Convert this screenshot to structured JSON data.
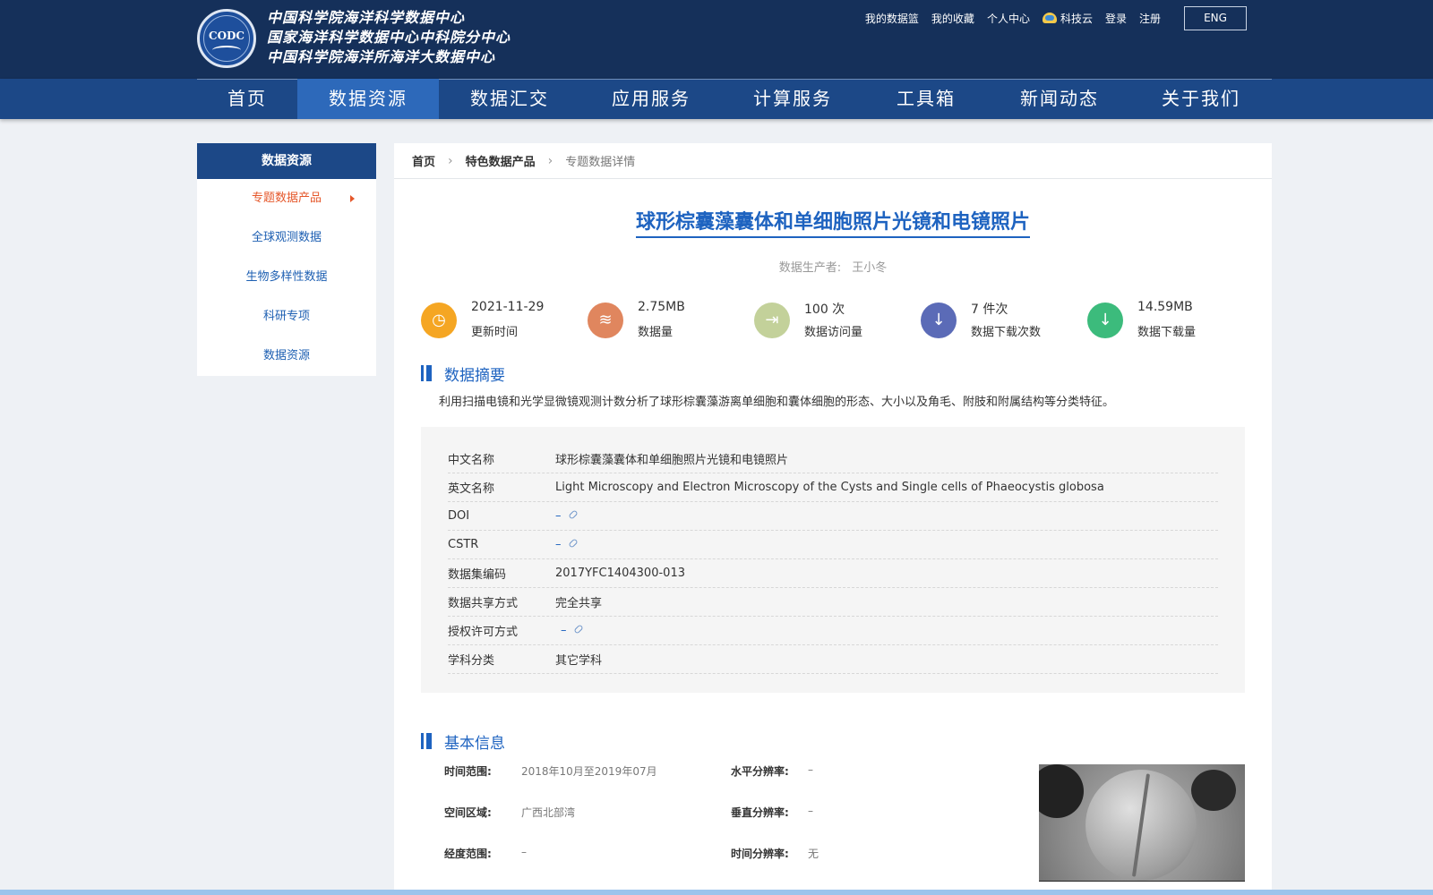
{
  "header": {
    "logo_text": "CODC",
    "org_names": [
      "中国科学院海洋科学数据中心",
      "国家海洋科学数据中心中科院分中心",
      "中国科学院海洋所海洋大数据中心"
    ],
    "top_links": [
      "我的数据篮",
      "我的收藏",
      "个人中心",
      "科技云",
      "登录",
      "注册"
    ],
    "lang_button": "ENG"
  },
  "nav": {
    "items": [
      "首页",
      "数据资源",
      "数据汇交",
      "应用服务",
      "计算服务",
      "工具箱",
      "新闻动态",
      "关于我们"
    ],
    "active": "数据资源"
  },
  "sidebar": {
    "title": "数据资源",
    "items": [
      "专题数据产品",
      "全球观测数据",
      "生物多样性数据",
      "科研专项",
      "数据资源"
    ],
    "active": "专题数据产品"
  },
  "breadcrumb": [
    "首页",
    "特色数据产品",
    "专题数据详情"
  ],
  "dataset": {
    "title": "球形棕囊藻囊体和单细胞照片光镜和电镜照片",
    "producer_label": "数据生产者:",
    "producer": "王小冬"
  },
  "stats": [
    {
      "value": "2021-11-29",
      "label": "更新时间",
      "icon": "clock-icon",
      "color": "#f5a623"
    },
    {
      "value": "2.75MB",
      "label": "数据量",
      "icon": "layers-icon",
      "color": "#e0865e"
    },
    {
      "value": "100 次",
      "label": "数据访问量",
      "icon": "enter-icon",
      "color": "#c3d19a"
    },
    {
      "value": "7 件次",
      "label": "数据下载次数",
      "icon": "download-icon",
      "color": "#5b6bb7"
    },
    {
      "value": "14.59MB",
      "label": "数据下载量",
      "icon": "download-icon",
      "color": "#3cbb7c"
    }
  ],
  "abstract": {
    "heading": "数据摘要",
    "text": "利用扫描电镜和光学显微镜观测计数分析了球形棕囊藻游离单细胞和囊体细胞的形态、大小以及角毛、附肢和附属结构等分类特征。"
  },
  "info_rows": [
    {
      "key": "中文名称",
      "value": "球形棕囊藻囊体和单细胞照片光镜和电镜照片"
    },
    {
      "key": "英文名称",
      "value": "Light Microscopy and Electron Microscopy of the Cysts and Single cells of Phaeocystis globosa"
    },
    {
      "key": "DOI",
      "value": "–"
    },
    {
      "key": "CSTR",
      "value": "–"
    },
    {
      "key": "数据集编码",
      "value": "2017YFC1404300-013"
    },
    {
      "key": "数据共享方式",
      "value": "完全共享"
    },
    {
      "key": "授权许可方式",
      "value": "–"
    },
    {
      "key": "学科分类",
      "value": "其它学科"
    }
  ],
  "basic_info": {
    "heading": "基本信息",
    "left": [
      {
        "key": "时间范围:",
        "value": "2018年10月至2019年07月"
      },
      {
        "key": "空间区域:",
        "value": "广西北部湾"
      },
      {
        "key": "经度范围:",
        "value": "–"
      }
    ],
    "right": [
      {
        "key": "水平分辨率:",
        "value": "–"
      },
      {
        "key": "垂直分辨率:",
        "value": "–"
      },
      {
        "key": "时间分辨率:",
        "value": "无"
      }
    ]
  }
}
